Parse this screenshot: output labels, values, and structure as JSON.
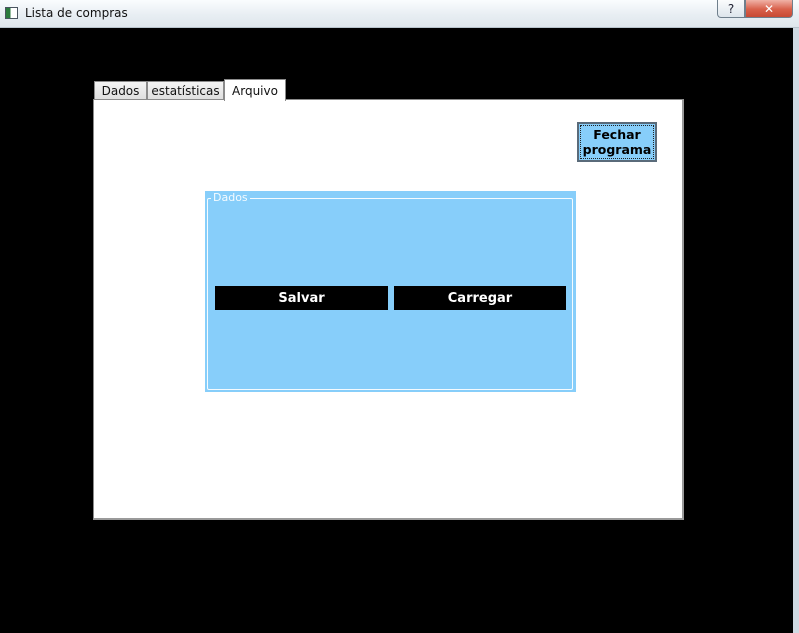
{
  "window": {
    "title": "Lista de compras",
    "help_label": "?",
    "close_label": "✕"
  },
  "tabs": [
    {
      "label": "Dados",
      "active": false
    },
    {
      "label": "estatísticas",
      "active": false
    },
    {
      "label": "Arquivo",
      "active": true
    }
  ],
  "arquivo_tab": {
    "close_program_label": "Fechar\nprograma",
    "group": {
      "title": "Dados",
      "save_label": "Salvar",
      "load_label": "Carregar"
    }
  },
  "colors": {
    "accent_blue": "#87cefa",
    "background": "#000000",
    "pane": "#ffffff"
  }
}
